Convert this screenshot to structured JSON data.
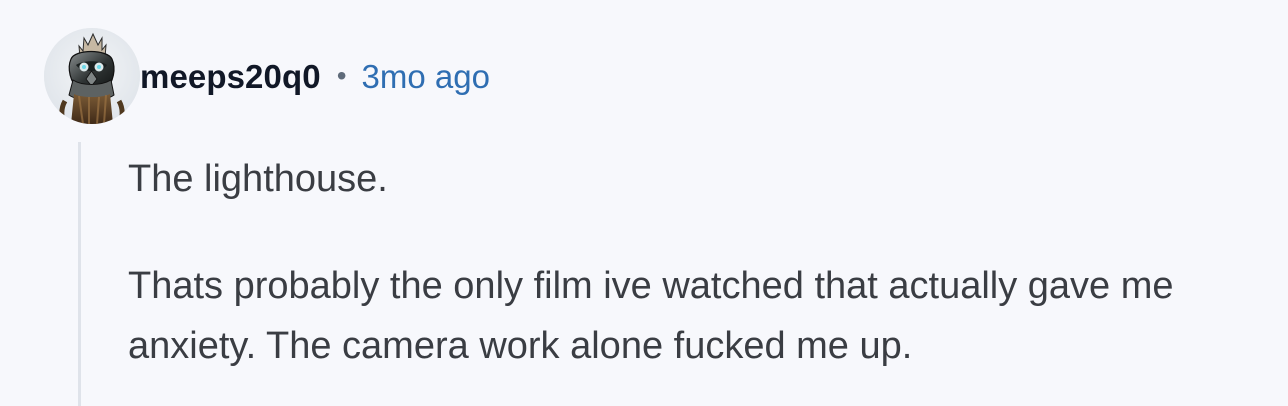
{
  "comment": {
    "avatar_icon": "robot-avatar-icon",
    "username": "meeps20q0",
    "separator": "•",
    "timestamp": "3mo ago",
    "paragraphs": [
      "The lighthouse.",
      "Thats probably the only film ive watched that actually gave me anxiety. The camera work alone fucked me up."
    ],
    "colors": {
      "background": "#f7f8fc",
      "timestamp": "#2f6eb2",
      "thread_line": "#dfe3ea"
    }
  }
}
